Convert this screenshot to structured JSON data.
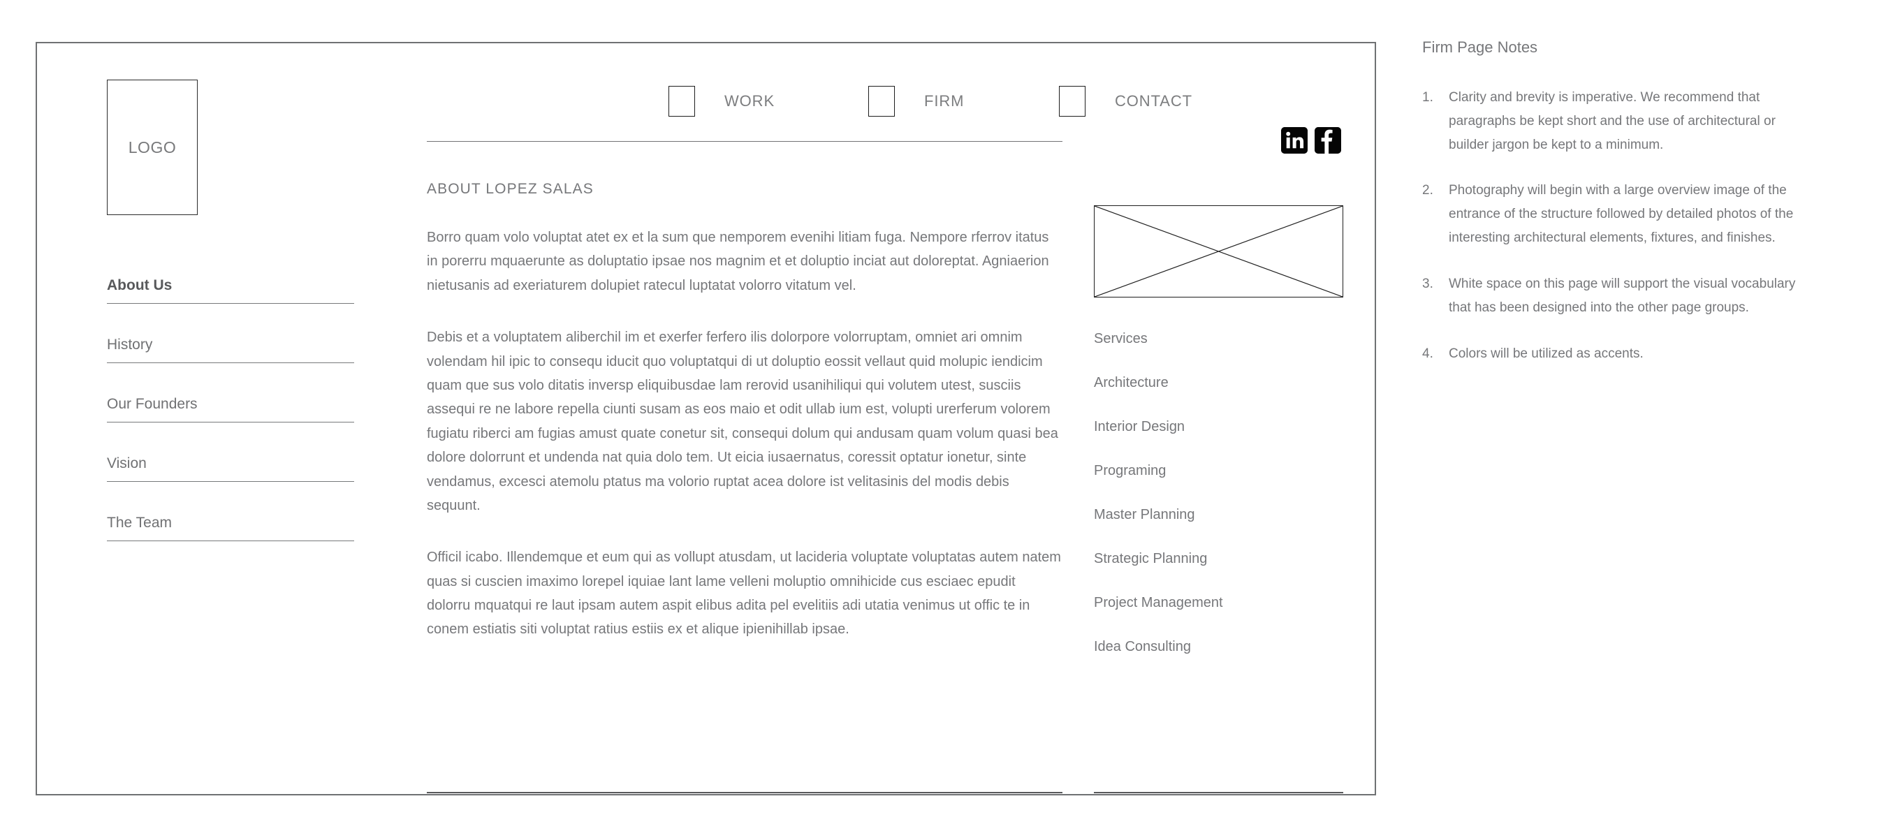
{
  "frame": {
    "label": "page-wireframe-frame"
  },
  "logo": {
    "text": "LOGO"
  },
  "top_nav": {
    "items": [
      {
        "label": "WORK",
        "icon": "square-placeholder-icon"
      },
      {
        "label": "FIRM",
        "icon": "square-placeholder-icon"
      },
      {
        "label": "CONTACT",
        "icon": "square-placeholder-icon"
      }
    ],
    "social": [
      {
        "name": "linkedin-icon",
        "glyph": "in",
        "color": "#050505"
      },
      {
        "name": "facebook-icon",
        "glyph": "f",
        "color": "#050505"
      }
    ]
  },
  "side_menu": {
    "items": [
      {
        "label": "About Us",
        "active": true
      },
      {
        "label": "History",
        "active": false
      },
      {
        "label": "Our Founders",
        "active": false
      },
      {
        "label": "Vision",
        "active": false
      },
      {
        "label": "The Team",
        "active": false
      }
    ]
  },
  "main": {
    "heading": "ABOUT LOPEZ SALAS",
    "paragraphs": [
      "Borro quam volo voluptat atet ex et la sum que nemporem evenihi litiam fuga. Nempore rferrov itatus in porerru mquaerunte as doluptatio ipsae nos magnim et et doluptio inciat aut doloreptat. Agniaerion nietusanis ad exeriaturem dolupiet ratecul luptatat volorro vitatum vel.",
      "Debis et a voluptatem aliberchil im et exerfer ferfero ilis dolorpore volorruptam, omniet ari omnim volendam hil ipic to consequ iducit quo voluptatqui di ut doluptio eossit vellaut quid molupic iendicim quam que sus volo ditatis inversp eliquibusdae lam rerovid usanihiliqui qui volutem utest, susciis assequi re ne labore repella ciunti susam as eos maio et odit ullab ium est, volupti urerferum volorem fugiatu riberci am fugias amust quate conetur sit, consequi dolum qui andusam quam volum quasi bea dolore dolorrunt et undenda nat quia dolo tem. Ut eicia iusaernatus, coressit optatur ionetur, sinte vendamus, excesci atemolu ptatus ma volorio ruptat acea dolore ist velitasinis del modis debis sequunt.",
      "Officil icabo. Illendemque et eum qui as vollupt atusdam, ut lacideria voluptate voluptatas autem natem quas si cuscien imaximo lorepel iquiae lant lame velleni moluptio omnihicide cus esciaec epudit dolorru mquatqui re laut ipsam autem aspit elibus adita pel evelitiis adi utatia venimus ut offic te in conem estiatis siti voluptat ratius estiis ex et alique ipienihillab ipsae."
    ]
  },
  "right_column": {
    "image_placeholder": {
      "name": "image-placeholder"
    },
    "services": [
      "Services",
      "Architecture",
      "Interior Design",
      "Programing",
      "Master Planning",
      "Strategic Planning",
      "Project Management",
      "Idea Consulting"
    ]
  },
  "notes": {
    "title": "Firm Page Notes",
    "items": [
      {
        "number": "1.",
        "text": "Clarity and brevity is imperative. We recommend that paragraphs be kept short and the use of architectural or builder jargon be kept to a minimum."
      },
      {
        "number": "2.",
        "text": "Photography will begin with a large overview image of the entrance of the structure followed by detailed photos of the interesting architectural elements, fixtures, and finishes."
      },
      {
        "number": "3.",
        "text": "White space on this page will support the visual vocabulary that has been designed into the other page groups."
      },
      {
        "number": "4.",
        "text": "Colors will be utilized as accents."
      }
    ]
  },
  "colors": {
    "frame_border": "#6f7173",
    "text_gray": "#76777a",
    "text_dark": "#58595b",
    "rule": "#727375",
    "icon_black": "#050505"
  }
}
